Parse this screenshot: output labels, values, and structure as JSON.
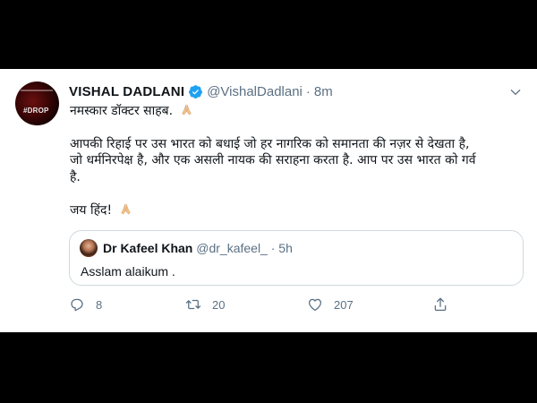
{
  "tweet": {
    "display_name": "VISHAL DADLANI",
    "handle": "@VishalDadlani",
    "separator": "·",
    "time": "8m",
    "avatar_badge": "#DROP",
    "lines": [
      "नमस्कार डॉक्टर साहब.",
      "आपकी रिहाई पर उस भारत को बधाई जो हर नागरिक को समानता की नज़र से देखता है,",
      "जो धर्मनिरपेक्ष है, और एक असली नायक की सराहना करता है. आप पर उस भारत को गर्व",
      "है.",
      "जय हिंद!"
    ]
  },
  "quoted": {
    "display_name": "Dr Kafeel Khan",
    "handle": "@dr_kafeel_",
    "separator": "·",
    "time": "5h",
    "text": "Asslam alaikum ."
  },
  "actions": {
    "reply_count": "8",
    "retweet_count": "20",
    "like_count": "207"
  },
  "colors": {
    "verified": "#1da1f2",
    "muted": "#5b7083",
    "text": "#0f1419",
    "border": "#cfd9de"
  },
  "icons": [
    "verified-badge-icon",
    "chevron-down-icon",
    "folded-hands-emoji",
    "reply-icon",
    "retweet-icon",
    "like-icon",
    "share-icon"
  ]
}
